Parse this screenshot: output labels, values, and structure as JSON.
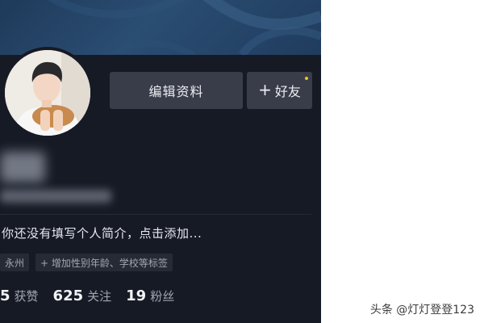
{
  "profile": {
    "edit_button": "编辑资料",
    "friend_button": "好友",
    "bio": "你还没有填写个人简介，点击添加...",
    "tags": [
      "永州",
      "+ 增加性别年龄、学校等标签"
    ],
    "stats": [
      {
        "num": "5",
        "label": "获赞"
      },
      {
        "num": "625",
        "label": "关注"
      },
      {
        "num": "19",
        "label": "粉丝"
      }
    ]
  },
  "watermark": "头条 @灯灯登登123",
  "colors": {
    "background": "#161a25",
    "button": "#393c49",
    "notification_dot": "#f5c518"
  }
}
